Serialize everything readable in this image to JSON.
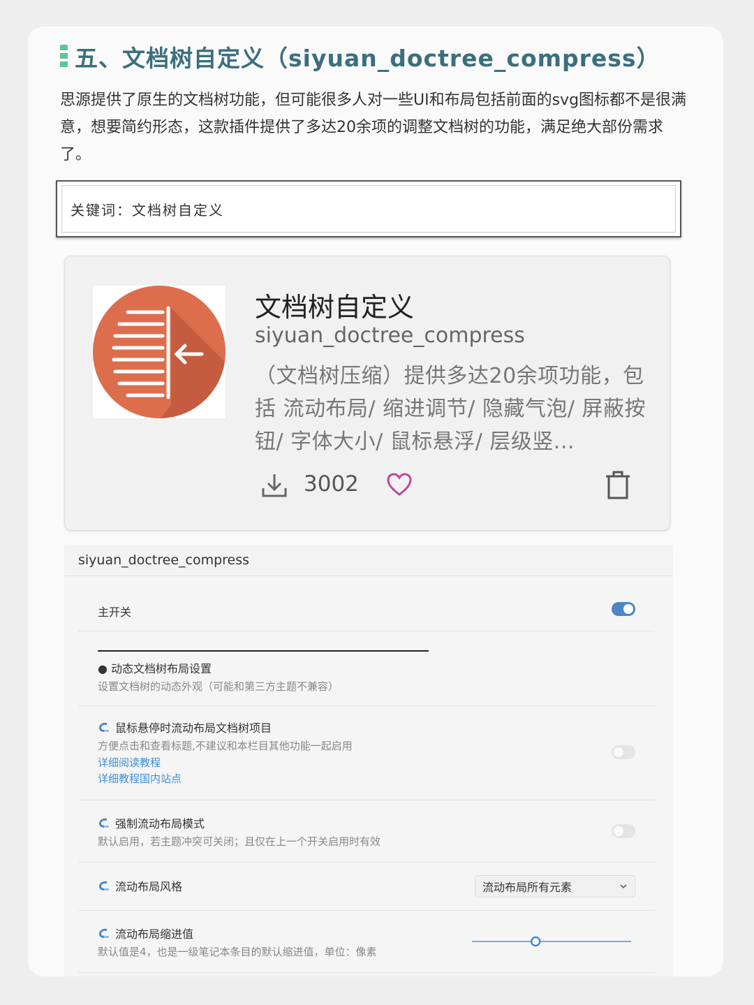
{
  "article": {
    "heading": "五、文档树自定义（siyuan_doctree_compress）",
    "intro": "思源提供了原生的文档树功能，但可能很多人对一些UI和布局包括前面的svg图标都不是很满意，想要简约形态，这款插件提供了多达20余项的调整文档树的功能，满足绝大部份需求了。",
    "keyword": "关键词：文档树自定义"
  },
  "plugin_card": {
    "icon": "doctree-compress-logo",
    "title": "文档树自定义",
    "name": "siyuan_doctree_compress",
    "description": "（文档树压缩）提供多达20余项功能，包括 流动布局/ 缩进调节/ 隐藏气泡/ 屏蔽按钮/ 字体大小/ 鼠标悬浮/ 层级竖...",
    "download_icon": "download-icon",
    "downloads": "3002",
    "favorite_icon": "heart-icon",
    "delete_icon": "trash-icon",
    "colors": {
      "icon_circle": "#dc6e4e",
      "heart": "#c0479b",
      "toggle_on": "#4c86c6",
      "link": "#3f8fd8"
    }
  },
  "settings": {
    "header": "siyuan_doctree_compress",
    "main_switch": {
      "label": "主开关",
      "on": true
    },
    "section": {
      "title": "● 动态文档树布局设置",
      "desc": "设置文档树的动态外观（可能和第三方主题不兼容）"
    },
    "items": [
      {
        "label": "鼠标悬停时流动布局文档树项目",
        "desc": "方便点击和查看标题,不建议和本栏目其他功能一起启用",
        "link1": "详细阅读教程",
        "link2": "详细教程国内站点",
        "on": false
      },
      {
        "label": "强制流动布局模式",
        "desc": "默认启用，若主题冲突可关闭；且仅在上一个开关启用时有效",
        "on": false
      },
      {
        "label": "流动布局风格",
        "select_value": "流动布局所有元素"
      },
      {
        "label": "流动布局缩进值",
        "desc": "默认值是4，也是一级笔记本条目的默认缩进值，单位：像素",
        "slider_value": 0.4
      }
    ]
  }
}
